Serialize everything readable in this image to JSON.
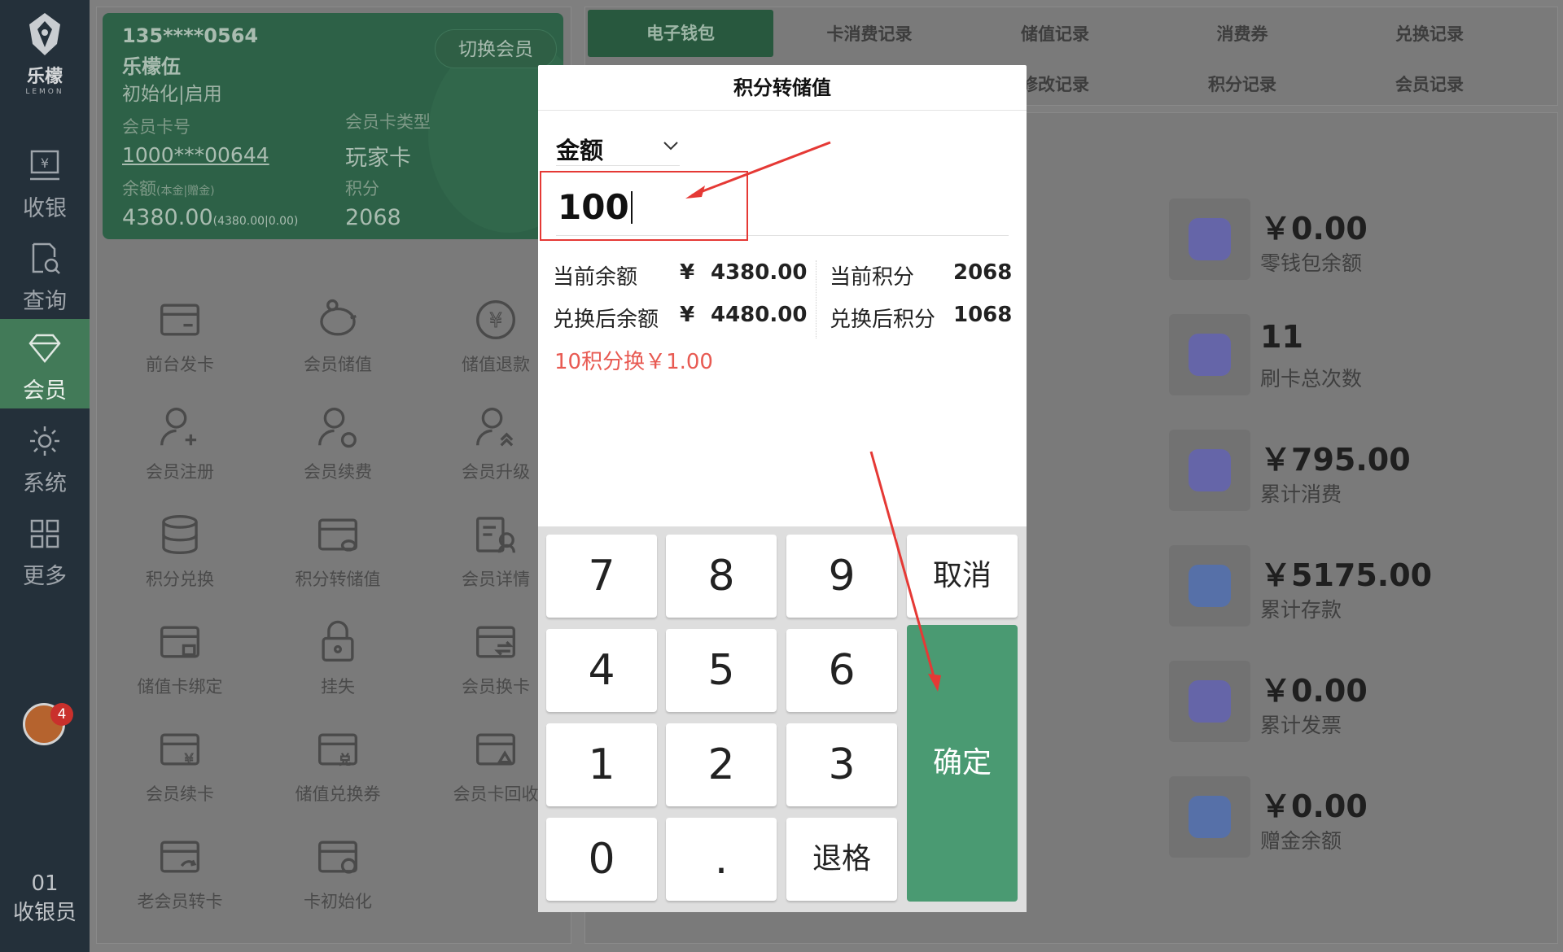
{
  "sidebar": {
    "logo_text": "乐檬",
    "logo_sub": "LEMON",
    "items": [
      {
        "label": "收银",
        "icon": "cash-register-icon"
      },
      {
        "label": "查询",
        "icon": "search-doc-icon"
      },
      {
        "label": "会员",
        "icon": "diamond-icon"
      },
      {
        "label": "系统",
        "icon": "gear-icon"
      },
      {
        "label": "更多",
        "icon": "grid-icon"
      }
    ],
    "notification_count": "4",
    "cashier_id": "01",
    "cashier_label": "收银员"
  },
  "card": {
    "phone": "135****0564",
    "name": "乐檬伍",
    "status": "初始化|启用",
    "card_no_label": "会员卡号",
    "card_no": "1000***00644",
    "card_type_label": "会员卡类型",
    "card_type": "玩家卡",
    "balance_label": "余额",
    "balance_sub": "(本金|赠金)",
    "balance": "4380.00",
    "balance_detail": "(4380.00|0.00)",
    "points_label": "积分",
    "points": "2068",
    "switch_label": "切换会员"
  },
  "functions": [
    "前台发卡",
    "会员储值",
    "储值退款",
    "会员注册",
    "会员续费",
    "会员升级",
    "积分兑换",
    "积分转储值",
    "会员详情",
    "储值卡绑定",
    "挂失",
    "会员换卡",
    "会员续卡",
    "储值兑换券",
    "会员卡回收",
    "老会员转卡",
    "卡初始化"
  ],
  "tabs": [
    "电子钱包",
    "卡消费记录",
    "储值记录",
    "消费券",
    "兑换记录",
    "修改记录",
    "积分记录",
    "会员记录"
  ],
  "stats": [
    {
      "value": "￥0.00",
      "label": "零钱包余额",
      "color": "#5b5bd6"
    },
    {
      "value": "11",
      "label": "刷卡总次数",
      "color": "#5b5bd6"
    },
    {
      "value": "￥795.00",
      "label": "累计消费",
      "color": "#5b5bd6"
    },
    {
      "value": "￥5175.00",
      "label": "累计存款",
      "color": "#3f6fd6"
    },
    {
      "value": "￥0.00",
      "label": "累计发票",
      "color": "#5b5bd6"
    },
    {
      "value": "￥0.00",
      "label": "赠金余额",
      "color": "#3f6fd6"
    }
  ],
  "modal": {
    "title": "积分转储值",
    "select_value": "金额",
    "amount": "100",
    "current_balance_label": "当前余额",
    "current_balance": "4380.00",
    "current_points_label": "当前积分",
    "current_points": "2068",
    "after_balance_label": "兑换后余额",
    "after_balance": "4480.00",
    "after_points_label": "兑换后积分",
    "after_points": "1068",
    "currency": "¥",
    "rate_note": "10积分换￥1.00"
  },
  "keypad": {
    "keys": [
      "7",
      "8",
      "9",
      "4",
      "5",
      "6",
      "1",
      "2",
      "3",
      "0",
      "."
    ],
    "cancel": "取消",
    "backspace": "退格",
    "confirm": "确定"
  }
}
